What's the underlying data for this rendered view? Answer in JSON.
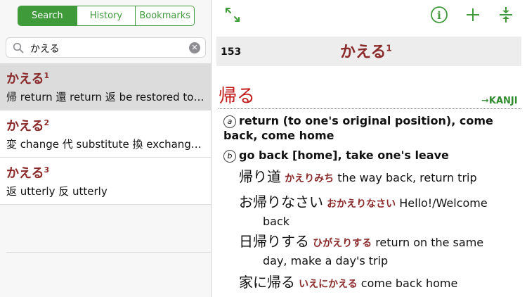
{
  "tabs": [
    {
      "label": "Search",
      "active": true
    },
    {
      "label": "History",
      "active": false
    },
    {
      "label": "Bookmarks",
      "active": false
    }
  ],
  "search": {
    "value": "かえる",
    "clear_symbol": "✕"
  },
  "results": [
    {
      "headword": "かえる",
      "sup": "1",
      "gloss": "帰 return 還 return 返 be restored to…",
      "selected": true
    },
    {
      "headword": "かえる",
      "sup": "2",
      "gloss": "変 change 代 substitute 換 exchang…",
      "selected": false
    },
    {
      "headword": "かえる",
      "sup": "3",
      "gloss": "返 utterly 反 utterly",
      "selected": false
    }
  ],
  "entry": {
    "page_number": "153",
    "title": "かえる",
    "title_sup": "1",
    "kanji": "帰る",
    "kanji_link": "➞KANJI",
    "senses": [
      {
        "mark": "a",
        "text": "return (to one's original position), come back, come home"
      },
      {
        "mark": "b",
        "text": "go back [home], take one's leave"
      }
    ],
    "examples": [
      {
        "jp": "帰り道",
        "kana": "かえりみち",
        "en": "the way back, return trip",
        "cont": ""
      },
      {
        "jp": "お帰りなさい",
        "kana": "おかえりなさい",
        "en": "Hello!/Welcome",
        "cont": "back"
      },
      {
        "jp": "日帰りする",
        "kana": "ひがえりする",
        "en": "return on the same",
        "cont": "day, make a day's trip"
      },
      {
        "jp": "家に帰る",
        "kana": "いえにかえる",
        "en": "come back home",
        "cont": ""
      }
    ]
  },
  "toolbar": {
    "info_symbol": "i",
    "add_symbol": "+"
  },
  "colors": {
    "accent": "#3f9a3a",
    "headword": "#8b2a2a",
    "kanji": "#c31a1a"
  }
}
